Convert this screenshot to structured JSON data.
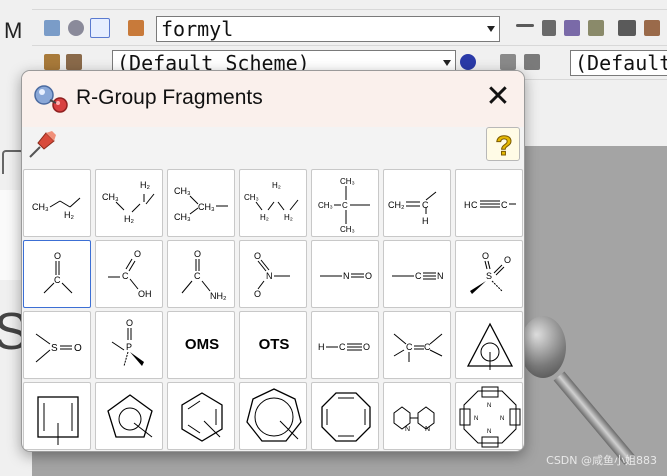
{
  "toolbar": {
    "formula_combo_value": "formyl",
    "scheme_combo_value": "(Default Scheme)",
    "scheme_combo_right_value": "(Default"
  },
  "dialog": {
    "title": "R-Group Fragments",
    "close_glyph": "✕",
    "help_glyph": "?"
  },
  "fragments": [
    {
      "id": "ethyl"
    },
    {
      "id": "propyl"
    },
    {
      "id": "isopropyl"
    },
    {
      "id": "butyl"
    },
    {
      "id": "tert-butyl"
    },
    {
      "id": "vinyl"
    },
    {
      "id": "ethynyl"
    },
    {
      "id": "acyl"
    },
    {
      "id": "carboxyl"
    },
    {
      "id": "carbamoyl"
    },
    {
      "id": "nitro"
    },
    {
      "id": "nitroso"
    },
    {
      "id": "cyano"
    },
    {
      "id": "sulfonyl"
    },
    {
      "id": "sulfinyl"
    },
    {
      "id": "phosphinyl"
    },
    {
      "id": "oms",
      "label": "OMS"
    },
    {
      "id": "ots",
      "label": "OTS"
    },
    {
      "id": "hco"
    },
    {
      "id": "cyclopropyl"
    },
    {
      "id": "trityl-like"
    },
    {
      "id": "cyclobutyl"
    },
    {
      "id": "cyclopentadienyl"
    },
    {
      "id": "phenyl"
    },
    {
      "id": "cycloheptatrienyl"
    },
    {
      "id": "cyclooctatetraenyl"
    },
    {
      "id": "bipyridyl"
    },
    {
      "id": "porphyrin"
    }
  ],
  "atom_labels": {
    "ch3": "CH₃",
    "ch2": "CH₂",
    "h2": "H₂",
    "h3": "H₃",
    "c": "C",
    "h": "H",
    "o": "O",
    "oh": "OH",
    "nh2": "NH₂",
    "n": "N",
    "s": "S",
    "p": "P"
  },
  "watermark": "CSDN @咸鱼小姐883",
  "colors": {
    "selection_border": "#3c6fd4",
    "title_bar_bg": "#faf0ec",
    "help_icon": "#e6b800"
  }
}
